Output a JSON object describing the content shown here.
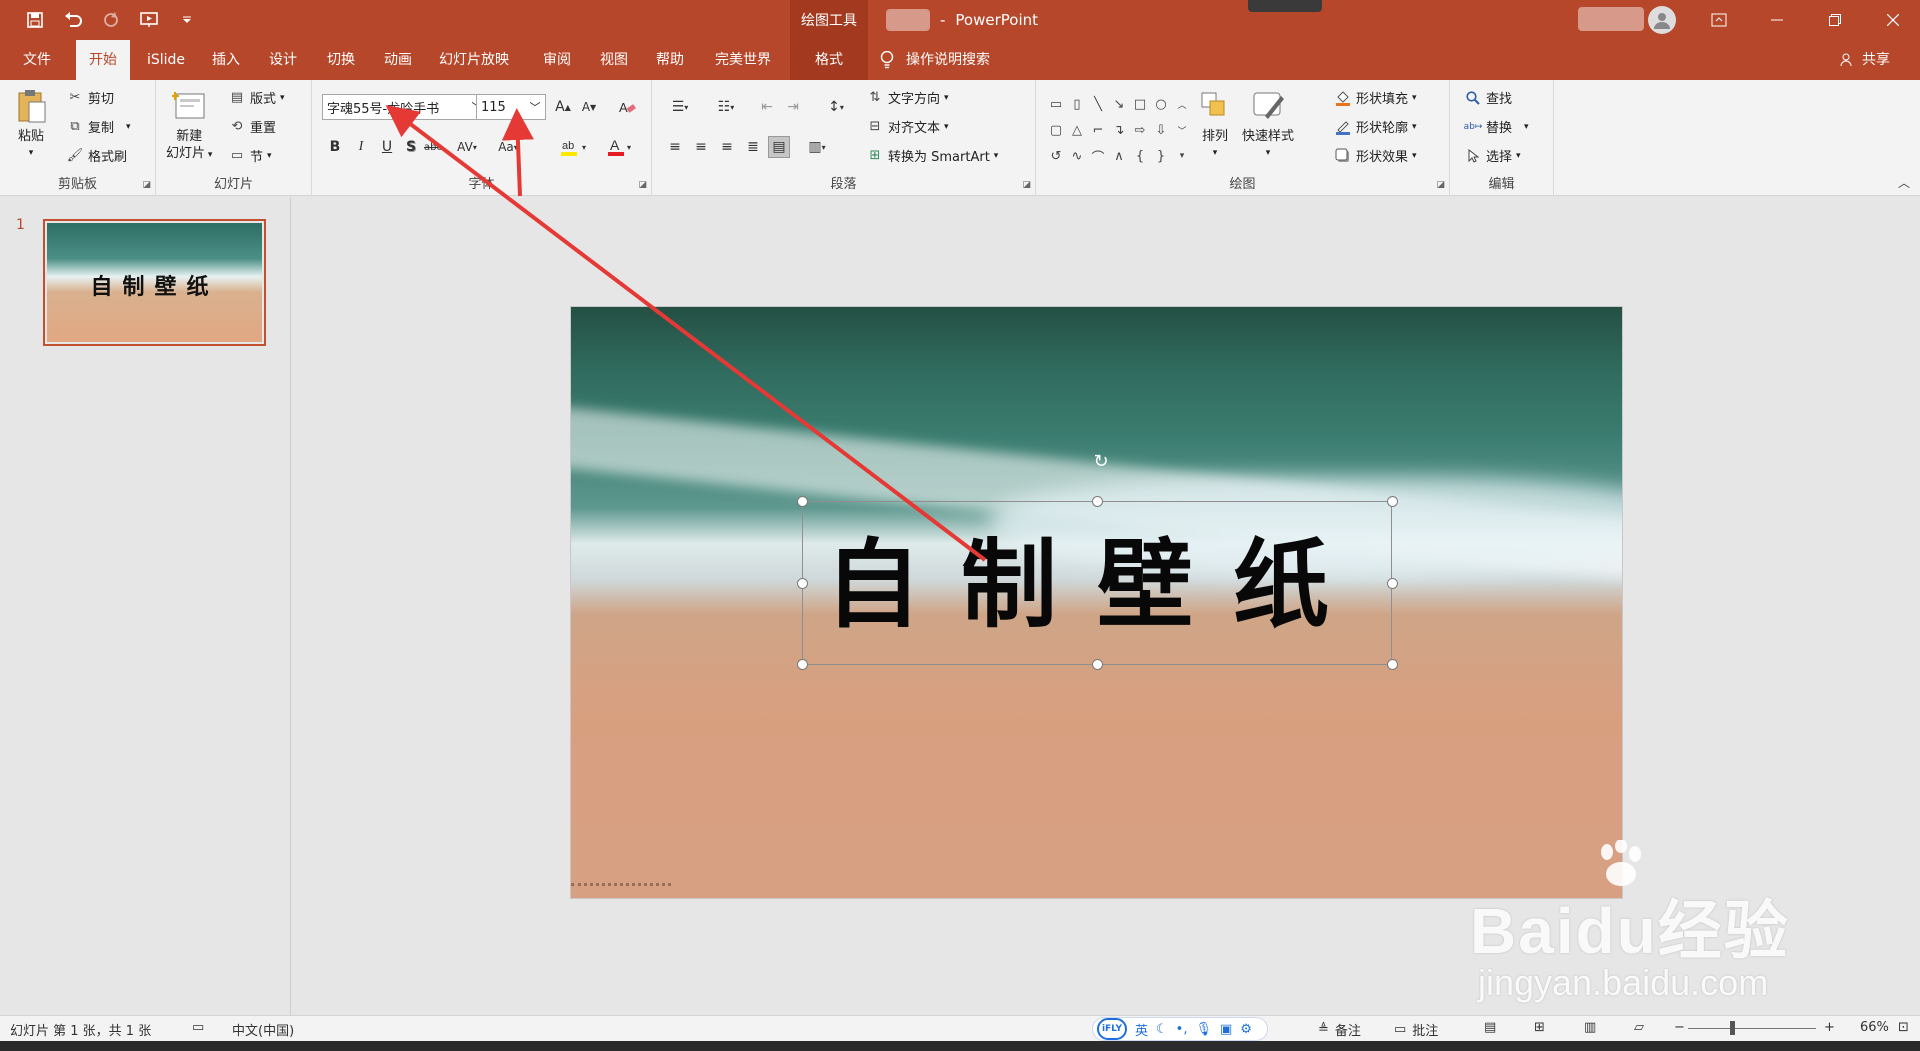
{
  "titlebar": {
    "context_tool": "绘图工具",
    "app_name": "PowerPoint",
    "qat_icons": [
      "save-icon",
      "undo-icon",
      "redo-icon",
      "present-from-start-icon",
      "customize-qat-icon"
    ]
  },
  "tabs": [
    {
      "id": "file",
      "label": "文件"
    },
    {
      "id": "home",
      "label": "开始"
    },
    {
      "id": "islide",
      "label": "iSlide"
    },
    {
      "id": "insert",
      "label": "插入"
    },
    {
      "id": "design",
      "label": "设计"
    },
    {
      "id": "transitions",
      "label": "切换"
    },
    {
      "id": "animations",
      "label": "动画"
    },
    {
      "id": "slideshow",
      "label": "幻灯片放映"
    },
    {
      "id": "review",
      "label": "审阅"
    },
    {
      "id": "view",
      "label": "视图"
    },
    {
      "id": "help",
      "label": "帮助"
    },
    {
      "id": "perfectworld",
      "label": "完美世界"
    },
    {
      "id": "format",
      "label": "格式"
    }
  ],
  "tell_me": "操作说明搜索",
  "share": "共享",
  "ribbon": {
    "clipboard": {
      "label": "剪贴板",
      "paste": "粘贴",
      "cut": "剪切",
      "copy": "复制",
      "format_painter": "格式刷"
    },
    "slides": {
      "label": "幻灯片",
      "new_slide_line1": "新建",
      "new_slide_line2": "幻灯片",
      "layout": "版式",
      "reset": "重置",
      "section": "节"
    },
    "font": {
      "label": "字体",
      "font_name": "字魂55号-龙吟手书",
      "font_size": "115"
    },
    "paragraph": {
      "label": "段落",
      "text_direction": "文字方向",
      "align_text": "对齐文本",
      "convert_smartart": "转换为 SmartArt"
    },
    "drawing": {
      "label": "绘图",
      "arrange": "排列",
      "quick_styles": "快速样式",
      "shape_fill": "形状填充",
      "shape_outline": "形状轮廓",
      "shape_effects": "形状效果"
    },
    "editing": {
      "label": "编辑",
      "find": "查找",
      "replace": "替换",
      "select": "选择"
    }
  },
  "thumbnails": [
    {
      "number": "1",
      "text": "自制壁纸"
    }
  ],
  "slide": {
    "text": "自制壁纸"
  },
  "watermark": {
    "brand": "Baidu经验",
    "url": "jingyan.baidu.com"
  },
  "statusbar": {
    "slide_info": "幻灯片 第 1 张，共 1 张",
    "language": "中文(中国)",
    "ime_logo": "iFLY",
    "ime_lang": "英",
    "notes": "备注",
    "comments": "批注",
    "zoom": "66%"
  },
  "colors": {
    "accent": "#b7472a",
    "ribbon_bg": "#f3f3f3",
    "annotation_arrow": "#e53935"
  }
}
